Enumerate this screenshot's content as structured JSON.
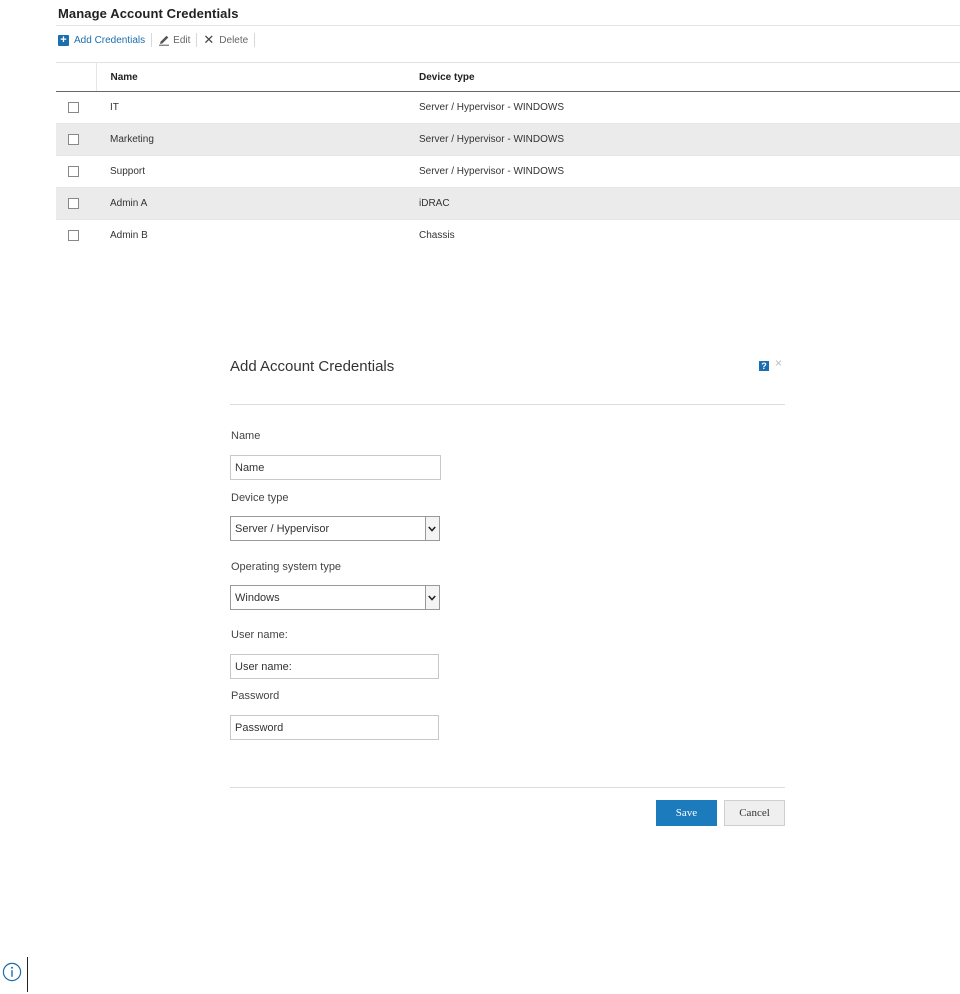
{
  "header": {
    "title": "Manage Account Credentials"
  },
  "toolbar": {
    "add_label": "Add Credentials",
    "edit_label": "Edit",
    "delete_label": "Delete"
  },
  "table": {
    "columns": [
      "Name",
      "Device type"
    ],
    "rows": [
      {
        "name": "IT",
        "device_type": "Server / Hypervisor - WINDOWS"
      },
      {
        "name": "Marketing",
        "device_type": "Server / Hypervisor - WINDOWS"
      },
      {
        "name": "Support",
        "device_type": "Server / Hypervisor - WINDOWS"
      },
      {
        "name": "Admin A",
        "device_type": "iDRAC"
      },
      {
        "name": "Admin B",
        "device_type": "Chassis"
      }
    ]
  },
  "dialog": {
    "title": "Add Account Credentials",
    "help_glyph": "?",
    "close_glyph": "×",
    "name_label": "Name",
    "name_placeholder": "Name",
    "device_type_label": "Device type",
    "device_type_value": "Server / Hypervisor",
    "os_type_label": "Operating system type",
    "os_type_value": "Windows",
    "username_label": "User name:",
    "username_placeholder": "User name:",
    "password_label": "Password",
    "password_placeholder": "Password",
    "save_label": "Save",
    "cancel_label": "Cancel"
  },
  "colors": {
    "accent": "#1b6fae",
    "save_button": "#1b7bbd",
    "alt_row": "#ebebeb"
  },
  "icons": {
    "add": "plus-icon",
    "edit": "pencil-icon",
    "delete": "x-icon",
    "help": "help-icon",
    "close": "close-icon",
    "dropdown": "chevron-down-icon",
    "footer": "info-icon"
  }
}
